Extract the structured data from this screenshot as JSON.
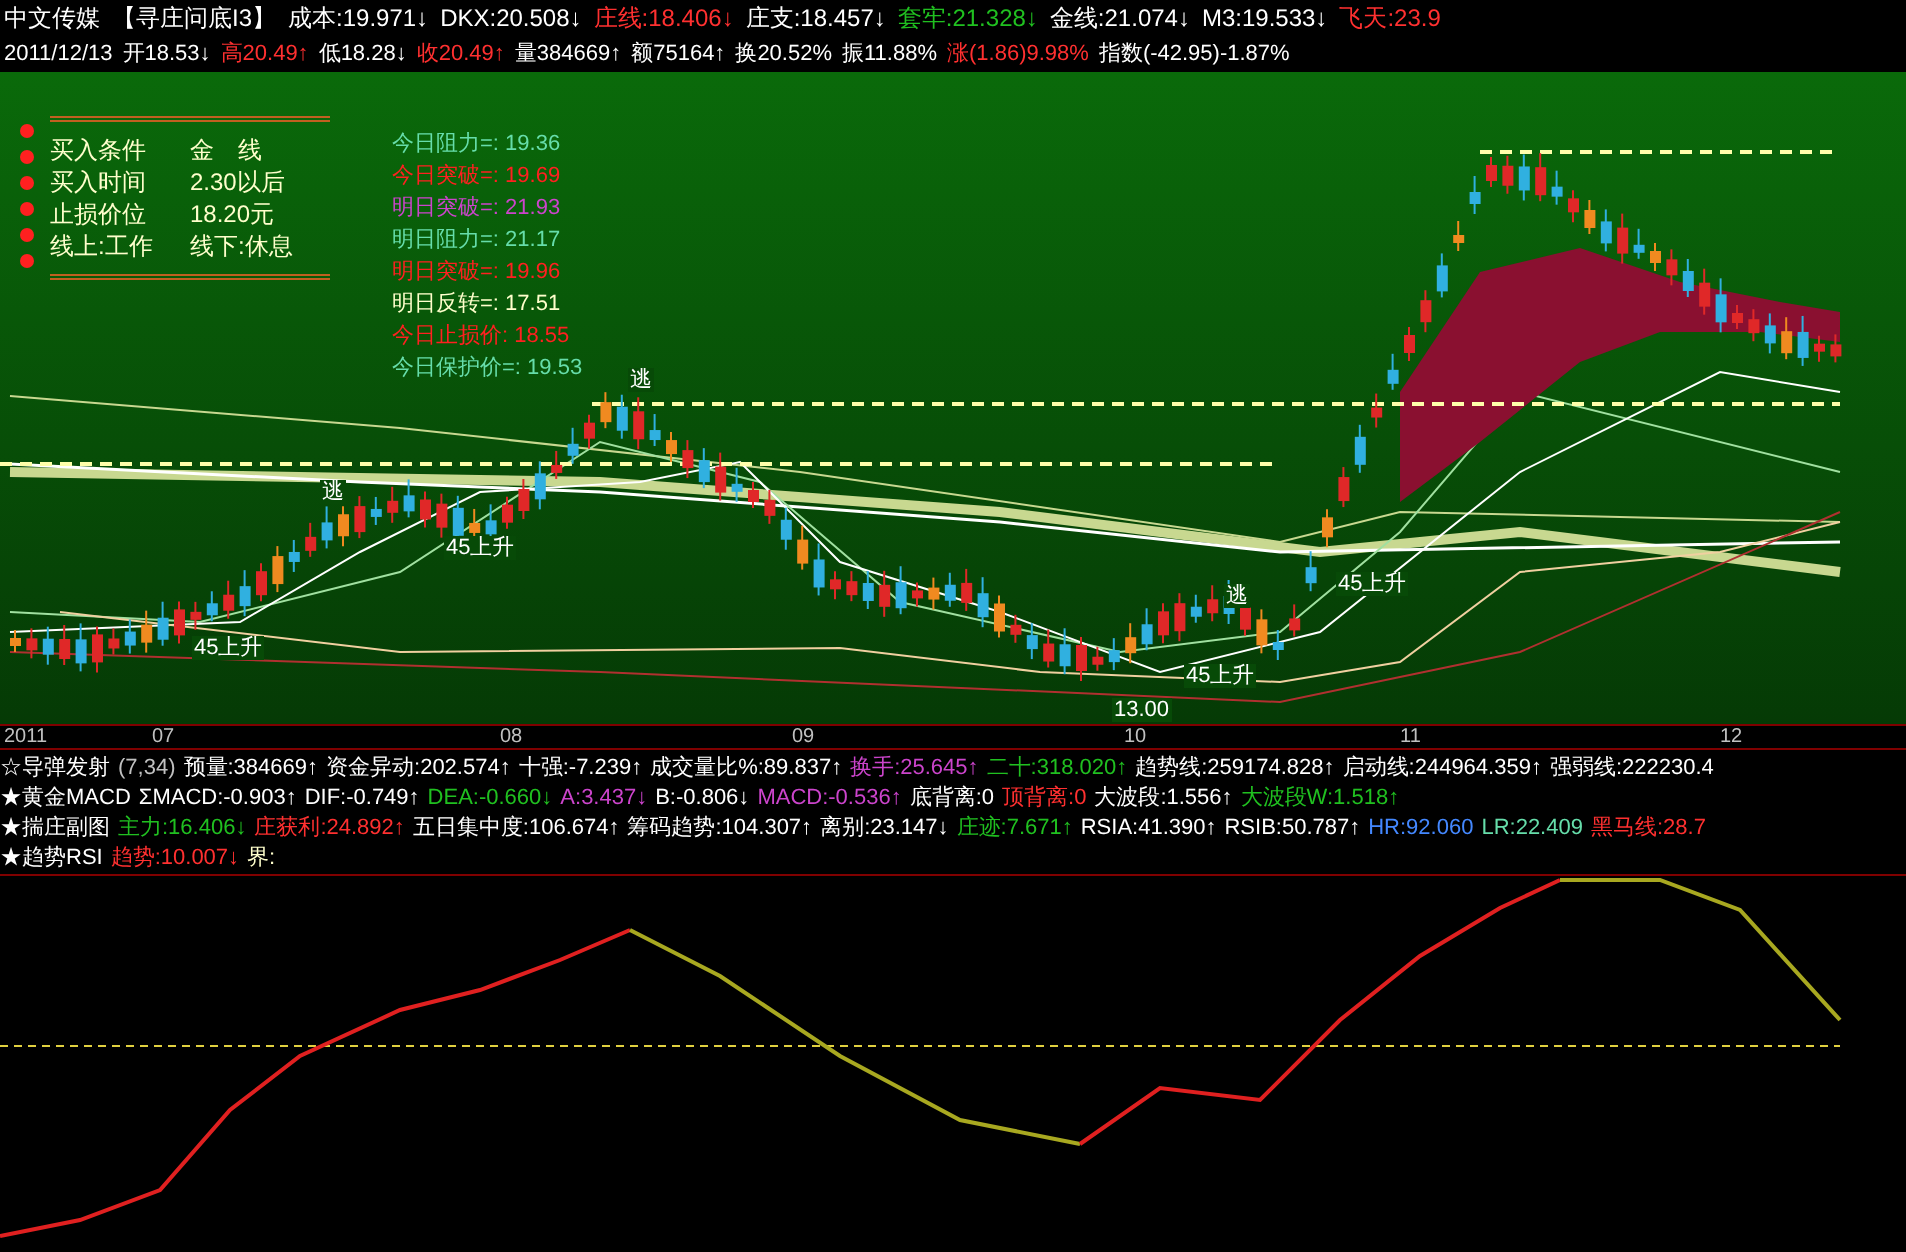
{
  "header": {
    "items": [
      {
        "text": "中文传媒",
        "color": "#ffffff"
      },
      {
        "text": "【寻庄问底I3】",
        "color": "#ffffff"
      },
      {
        "text": "成本:19.971↓",
        "color": "#ffffff"
      },
      {
        "text": "DKX:20.508↓",
        "color": "#ffffff"
      },
      {
        "text": "庄线:18.406↓",
        "color": "#ff3030"
      },
      {
        "text": "庄支:18.457↓",
        "color": "#ffffff"
      },
      {
        "text": "套牢:21.328↓",
        "color": "#20c020"
      },
      {
        "text": "金线:21.074↓",
        "color": "#ffffff"
      },
      {
        "text": "M3:19.533↓",
        "color": "#ffffff"
      },
      {
        "text": "飞天:23.9",
        "color": "#ff3030"
      }
    ]
  },
  "quote": [
    {
      "text": "2011/12/13",
      "color": "#ffffff"
    },
    {
      "text": "开18.53↓",
      "color": "#ffffff"
    },
    {
      "text": "高20.49↑",
      "color": "#ff3030"
    },
    {
      "text": "低18.28↓",
      "color": "#ffffff"
    },
    {
      "text": "收20.49↑",
      "color": "#ff3030"
    },
    {
      "text": "量384669↑",
      "color": "#ffffff"
    },
    {
      "text": "额75164↑",
      "color": "#ffffff"
    },
    {
      "text": "换20.52%",
      "color": "#ffffff"
    },
    {
      "text": "振11.88%",
      "color": "#ffffff"
    },
    {
      "text": "涨(1.86)9.98%",
      "color": "#ff3030"
    },
    {
      "text": "指数(-42.95)-1.87%",
      "color": "#ffffff"
    }
  ],
  "conditions": [
    {
      "label": "买入条件",
      "value": "金　线"
    },
    {
      "label": "买入时间",
      "value": "2.30以后"
    },
    {
      "label": "止损价位",
      "value": "18.20元"
    },
    {
      "label": "线上:工作",
      "value": "线下:休息"
    }
  ],
  "levels": [
    {
      "text": "今日阻力=: 19.36",
      "color": "#66ddaa"
    },
    {
      "text": "今日突破=: 19.69",
      "color": "#ff2020"
    },
    {
      "text": "明日突破=: 21.93",
      "color": "#cc44cc"
    },
    {
      "text": "明日阻力=: 21.17",
      "color": "#66ddaa"
    },
    {
      "text": "明日突破=: 19.96",
      "color": "#ff2020"
    },
    {
      "text": "明日反转=: 17.51",
      "color": "#ffffcc"
    },
    {
      "text": "今日止损价: 18.55",
      "color": "#ff2020"
    },
    {
      "text": "今日保护价=: 19.53",
      "color": "#66ddaa"
    }
  ],
  "chart_labels": [
    {
      "text": "逃"
    },
    {
      "text": "逃"
    },
    {
      "text": "逃"
    },
    {
      "text": "45上升"
    },
    {
      "text": "45上升"
    },
    {
      "text": "45上升"
    },
    {
      "text": "45上升"
    },
    {
      "text": "13.00"
    }
  ],
  "axis": [
    "2011",
    "07",
    "08",
    "09",
    "10",
    "11",
    "12"
  ],
  "indicators": [
    {
      "title": "☆导弹发射",
      "items": [
        {
          "text": "(7,34)",
          "color": "#c0c0c0"
        },
        {
          "text": "预量:384669↑",
          "color": "#ffffff"
        },
        {
          "text": "资金异动:202.574↑",
          "color": "#ffffff"
        },
        {
          "text": "十强:-7.239↑",
          "color": "#ffffff"
        },
        {
          "text": "成交量比%:89.837↑",
          "color": "#ffffff"
        },
        {
          "text": "换手:25.645↑",
          "color": "#cc44cc"
        },
        {
          "text": "二十:318.020↑",
          "color": "#20c020"
        },
        {
          "text": "趋势线:259174.828↑",
          "color": "#ffffff"
        },
        {
          "text": "启动线:244964.359↑",
          "color": "#ffffff"
        },
        {
          "text": "强弱线:222230.4",
          "color": "#ffffff"
        }
      ]
    },
    {
      "title": "★黄金MACD",
      "items": [
        {
          "text": "ΣMACD:-0.903↑",
          "color": "#ffffff"
        },
        {
          "text": "DIF:-0.749↑",
          "color": "#ffffff"
        },
        {
          "text": "DEA:-0.660↓",
          "color": "#20c020"
        },
        {
          "text": "A:3.437↓",
          "color": "#cc44cc"
        },
        {
          "text": "B:-0.806↓",
          "color": "#ffffff"
        },
        {
          "text": "MACD:-0.536↑",
          "color": "#cc44cc"
        },
        {
          "text": "底背离:0",
          "color": "#ffffff"
        },
        {
          "text": "顶背离:0",
          "color": "#ff3030"
        },
        {
          "text": "大波段:1.556↑",
          "color": "#ffffff"
        },
        {
          "text": "大波段W:1.518↑",
          "color": "#20c020"
        }
      ]
    },
    {
      "title": "★揣庄副图",
      "items": [
        {
          "text": "主力:16.406↓",
          "color": "#20c020"
        },
        {
          "text": "庄获利:24.892↑",
          "color": "#ff3030"
        },
        {
          "text": "五日集中度:106.674↑",
          "color": "#ffffff"
        },
        {
          "text": "筹码趋势:104.307↑",
          "color": "#ffffff"
        },
        {
          "text": "离别:23.147↓",
          "color": "#ffffff"
        },
        {
          "text": "庄迹:7.671↑",
          "color": "#20c020"
        },
        {
          "text": "RSIA:41.390↑",
          "color": "#ffffff"
        },
        {
          "text": "RSIB:50.787↑",
          "color": "#ffffff"
        },
        {
          "text": "HR:92.060",
          "color": "#4488ff"
        },
        {
          "text": "LR:22.409",
          "color": "#66ddaa"
        },
        {
          "text": "黑马线:28.7",
          "color": "#ff3030"
        }
      ]
    },
    {
      "title": "★趋势RSI",
      "items": [
        {
          "text": "趋势:10.007↓",
          "color": "#ff3030"
        },
        {
          "text": "界:",
          "color": "#ffffcc"
        }
      ]
    }
  ]
}
